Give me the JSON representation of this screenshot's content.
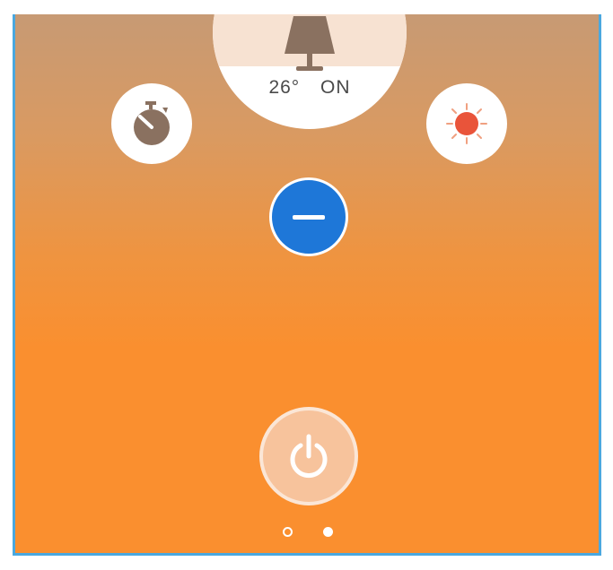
{
  "device": {
    "temperature": "26°",
    "state": "ON",
    "icon": "lamp-icon"
  },
  "controls": {
    "timer_icon": "stopwatch-icon",
    "brightness_icon": "sun-icon",
    "decrease_icon": "minus-icon",
    "power_icon": "power-icon"
  },
  "pager": {
    "total_pages": 2,
    "active_page": 2
  },
  "colors": {
    "accent_blue": "#1e77d8",
    "background_orange": "#fa8f2f",
    "sun_red": "#e9543a",
    "icon_brown": "#8a7160"
  }
}
